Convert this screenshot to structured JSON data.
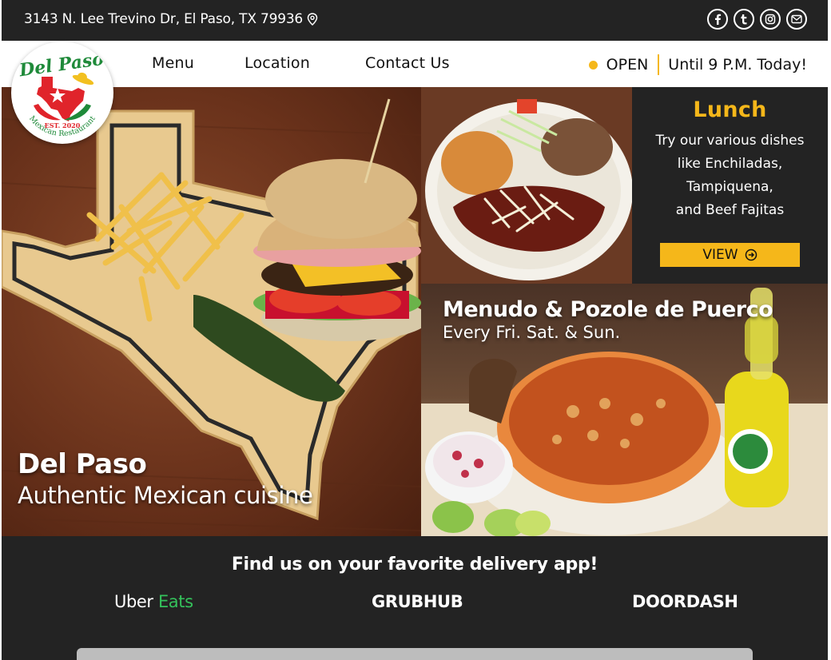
{
  "topbar": {
    "address": "3143 N. Lee Trevino Dr, El Paso, TX 79936",
    "socials": [
      "facebook-icon",
      "tumblr-icon",
      "instagram-icon",
      "email-icon"
    ]
  },
  "logo": {
    "script": "Del Paso",
    "est": "EST. 2020",
    "subtitle": "Mexican Restaurant"
  },
  "nav": {
    "items": [
      {
        "label": "Menu"
      },
      {
        "label": "Location"
      },
      {
        "label": "Contact Us"
      }
    ],
    "status": "OPEN",
    "hours": "Until 9 P.M. Today!"
  },
  "hero": {
    "title": "Del Paso",
    "subtitle": "Authentic Mexican cuisine"
  },
  "lunch": {
    "title": "Lunch",
    "lines": [
      "Try our various dishes",
      "like Enchiladas,",
      "Tampiquena,",
      "and Beef Fajitas"
    ],
    "button": "VIEW"
  },
  "special": {
    "title": "Menudo & Pozole de Puerco",
    "subtitle": "Every Fri. Sat. & Sun."
  },
  "delivery": {
    "heading": "Find us on your favorite delivery app!",
    "uber_a": "Uber",
    "uber_b": "Eats",
    "grubhub": "GRUBHUB",
    "doordash": "DOORDASH"
  },
  "colors": {
    "accent": "#f5b71a",
    "dark": "#232323",
    "uber_green": "#34c15b"
  }
}
